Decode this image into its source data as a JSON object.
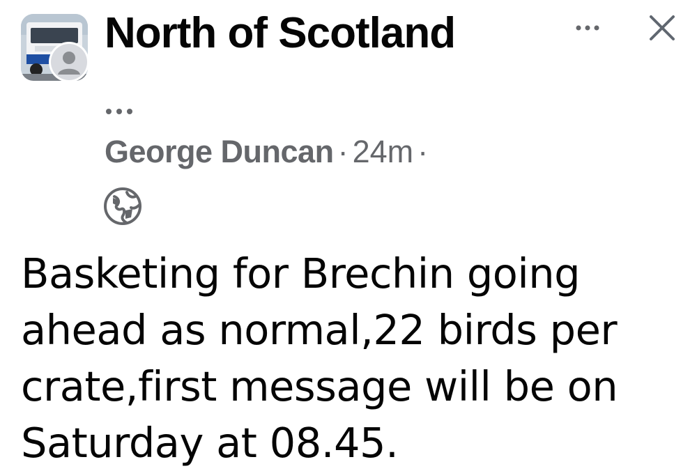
{
  "header": {
    "group_name": "North of Scotland",
    "more_icon": "ellipsis-horizontal-icon",
    "close_icon": "close-icon"
  },
  "group_avatar": {
    "icon": "truck-photo",
    "user_avatar_icon": "default-profile-icon"
  },
  "post": {
    "admin_menu_icon": "ellipsis-horizontal-icon",
    "author": "George Duncan",
    "separator": "·",
    "time": "24m",
    "trailing_separator": "·",
    "audience_icon": "globe-icon",
    "text_lines": [
      "Basketing for Brechin going",
      "ahead as normal,22 birds per",
      "crate,first message will be on",
      "Saturday at 08.45."
    ]
  },
  "colors": {
    "text_primary": "#050505",
    "text_secondary": "#65676b",
    "background": "#ffffff"
  }
}
